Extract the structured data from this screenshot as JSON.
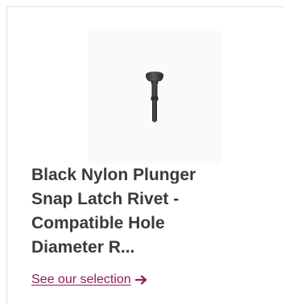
{
  "product": {
    "title": "Black Nylon Plunger\nSnap Latch Rivet -\nCompatible Hole\nDiameter R...",
    "image_icon": "rivet-icon",
    "cta_label": "See our selection",
    "cta_icon": "arrow-right-icon"
  },
  "colors": {
    "title": "#3a3a3a",
    "link": "#8c1d57",
    "border": "#e0e0e0",
    "rivet": "#3a3d40"
  }
}
